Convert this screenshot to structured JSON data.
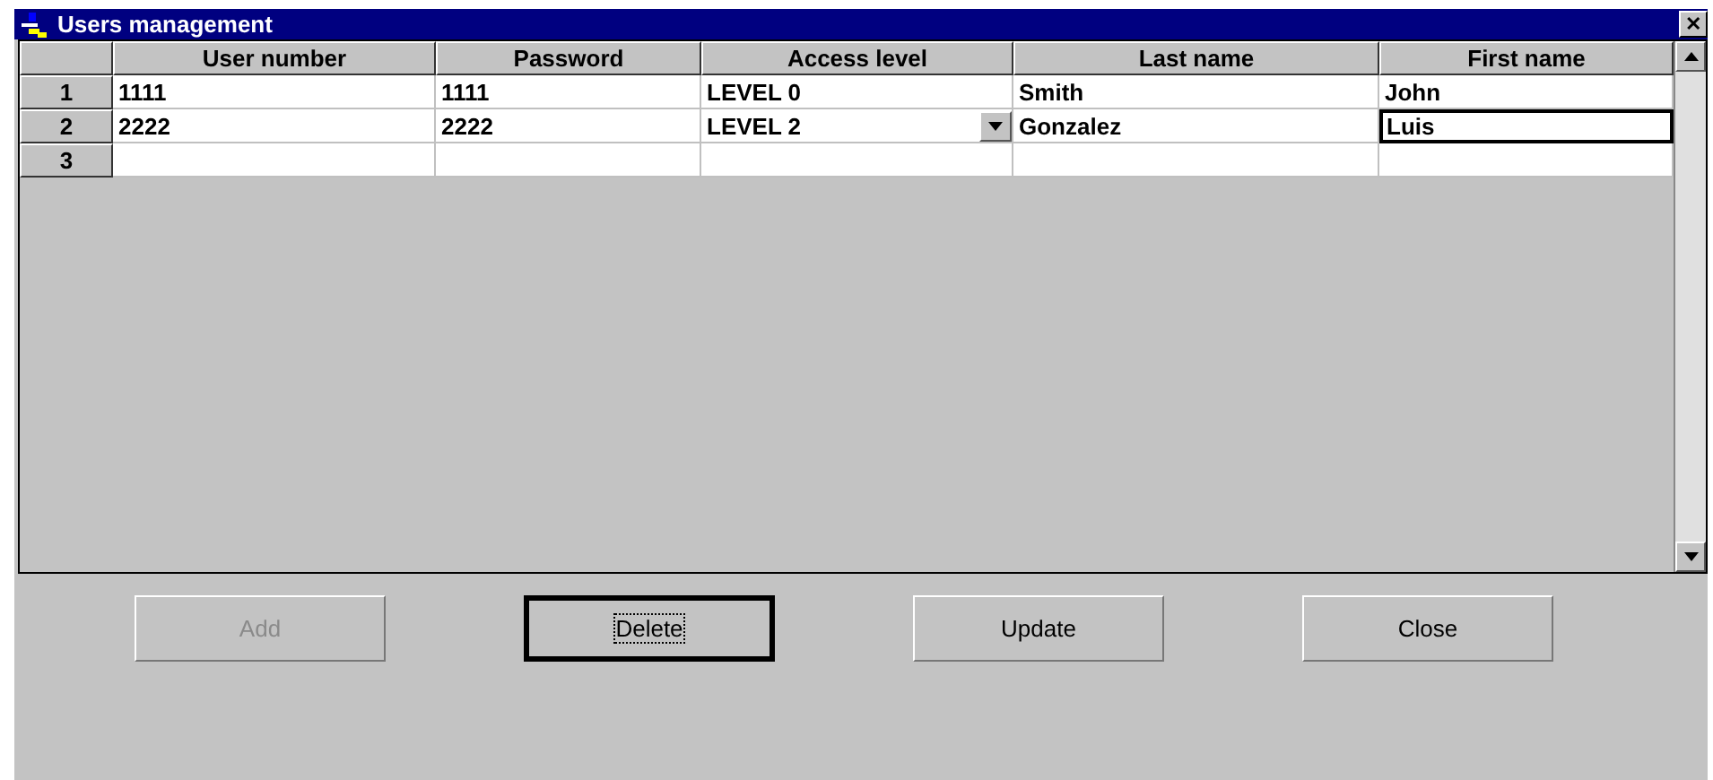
{
  "window": {
    "title": "Users management",
    "close": "✕"
  },
  "table": {
    "columns": [
      "User number",
      "Password",
      "Access level",
      "Last name",
      "First name"
    ],
    "rows": [
      {
        "number": "1",
        "cells": [
          {
            "text": "1111",
            "kind": "text",
            "selected": false
          },
          {
            "text": "1111",
            "kind": "text",
            "selected": false
          },
          {
            "text": "LEVEL 0",
            "kind": "text",
            "selected": false
          },
          {
            "text": "Smith",
            "kind": "text",
            "selected": false
          },
          {
            "text": "John",
            "kind": "text",
            "selected": false
          }
        ]
      },
      {
        "number": "2",
        "cells": [
          {
            "text": "2222",
            "kind": "text",
            "selected": false
          },
          {
            "text": "2222",
            "kind": "text",
            "selected": false
          },
          {
            "text": "LEVEL 2",
            "kind": "dropdown",
            "selected": false
          },
          {
            "text": "Gonzalez",
            "kind": "text",
            "selected": false
          },
          {
            "text": "Luis",
            "kind": "text",
            "selected": true
          }
        ]
      },
      {
        "number": "3"
      }
    ]
  },
  "buttons": [
    {
      "label": "Add",
      "disabled": true,
      "focused": false
    },
    {
      "label": "Delete",
      "disabled": false,
      "focused": true
    },
    {
      "label": "Update",
      "disabled": false,
      "focused": false
    },
    {
      "label": "Close",
      "disabled": false,
      "focused": false
    }
  ]
}
